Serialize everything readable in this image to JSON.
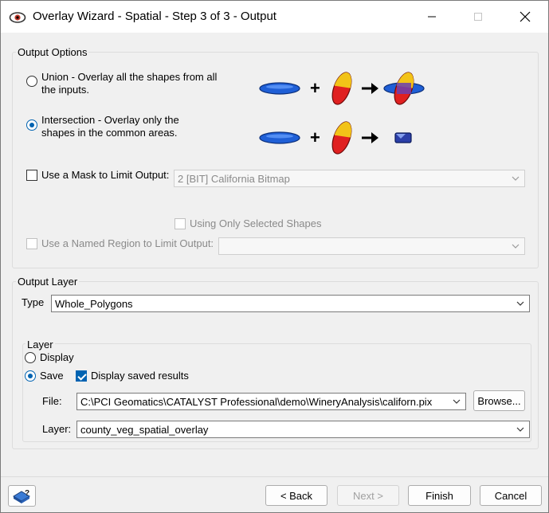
{
  "window": {
    "title": "Overlay Wizard - Spatial - Step 3 of 3 - Output"
  },
  "output_options": {
    "legend": "Output Options",
    "union_label_line1": "Union - Overlay all the shapes from all",
    "union_label_line2": "the inputs.",
    "intersection_label_line1": "Intersection - Overlay only the",
    "intersection_label_line2": "shapes in the common areas.",
    "selected": "intersection",
    "use_mask_label": "Use a Mask to Limit Output:",
    "mask_value": "2 [BIT] California Bitmap",
    "using_selected_label": "Using Only Selected Shapes",
    "named_region_label": "Use a Named Region to Limit Output:",
    "named_region_value": "",
    "plus_symbol": "+",
    "arrow_symbol": "→"
  },
  "output_layer": {
    "legend": "Output Layer",
    "type_label": "Type",
    "type_value": "Whole_Polygons",
    "layer_group": {
      "legend": "Layer",
      "display_label": "Display",
      "save_label": "Save",
      "display_saved_label": "Display saved results",
      "display_saved_checked": true,
      "selected": "save",
      "file_label": "File:",
      "file_value": "C:\\PCI Geomatics\\CATALYST Professional\\demo\\WineryAnalysis\\californ.pix",
      "browse_label": "Browse...",
      "layer_label": "Layer:",
      "layer_value": "county_veg_spatial_overlay"
    }
  },
  "footer": {
    "back_label": "< Back",
    "next_label": "Next >",
    "finish_label": "Finish",
    "cancel_label": "Cancel"
  },
  "colors": {
    "accent": "#0063b1",
    "shape_blue": "#1f5fd6",
    "shape_red": "#e02020",
    "shape_yellow": "#f2c318"
  }
}
